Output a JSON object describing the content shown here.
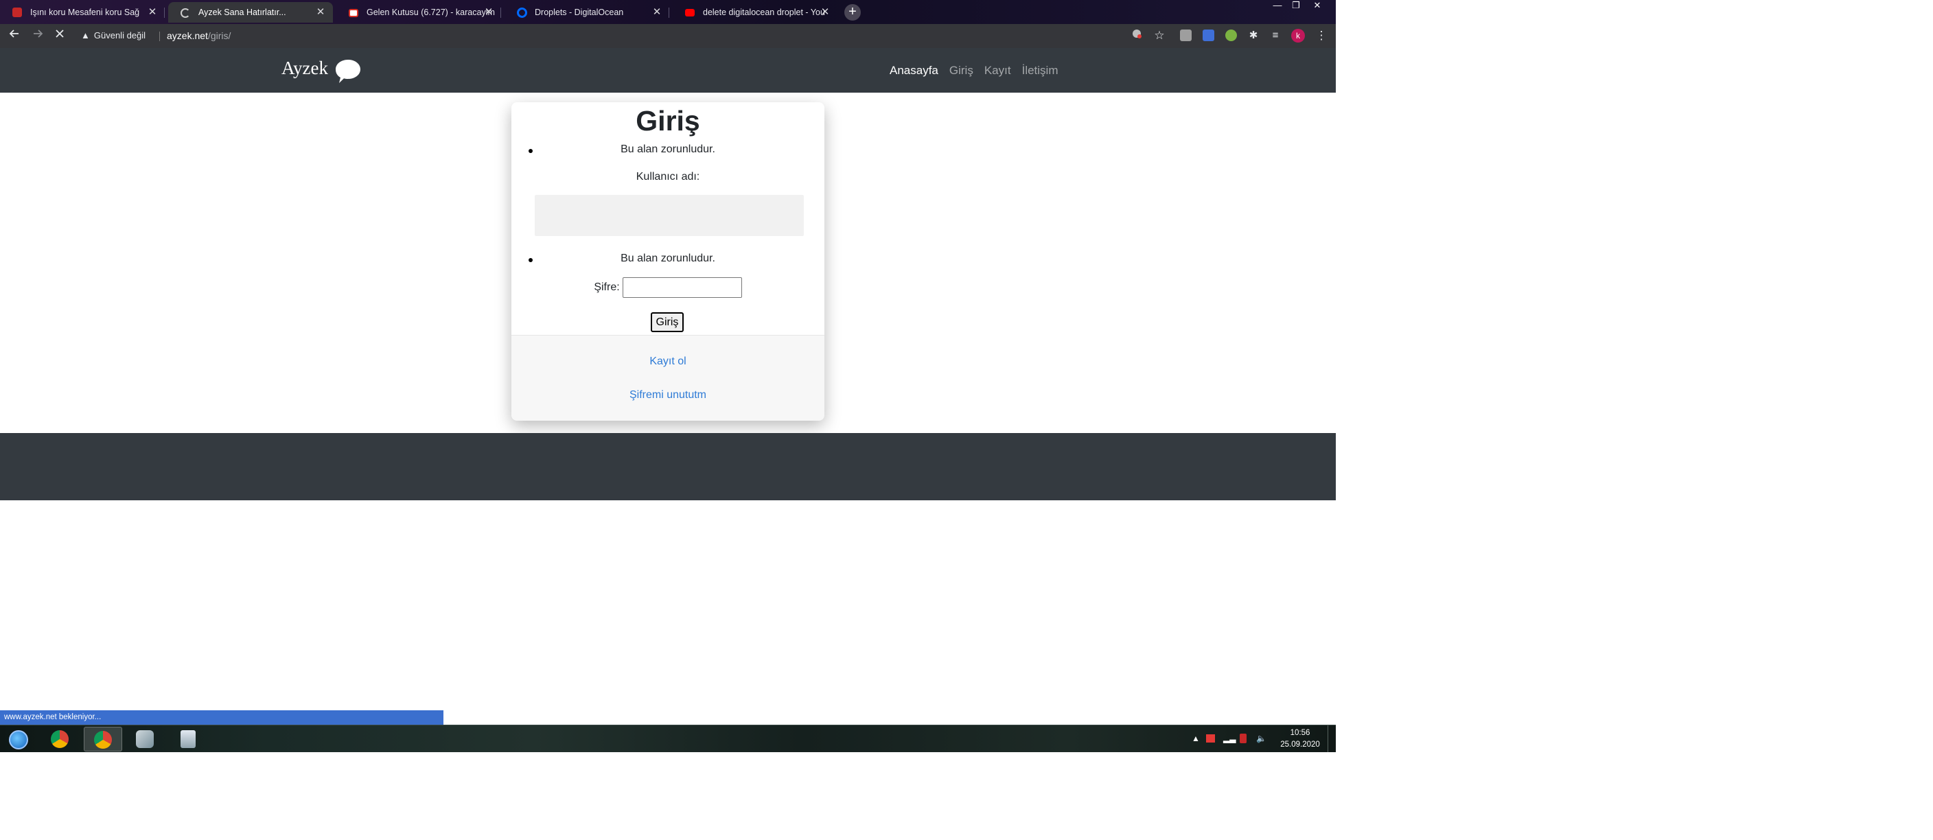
{
  "browser": {
    "tabs": [
      {
        "title": "Işını koru Mesafeni koru Sağ",
        "favicon_color": "#c62828",
        "active": false
      },
      {
        "title": "Ayzek Sana Hatırlatır...",
        "favicon_color": "#cccccc",
        "active": true
      },
      {
        "title": "Gelen Kutusu (6.727) - karacaylm",
        "favicon_color": "#d93025",
        "active": false
      },
      {
        "title": "Droplets - DigitalOcean",
        "favicon_color": "#0069ff",
        "active": false
      },
      {
        "title": "delete digitalocean droplet - You",
        "favicon_color": "#ff0000",
        "active": false
      }
    ],
    "new_tab_symbol": "+",
    "window_controls": {
      "minimize": "—",
      "restore": "❐",
      "close": "✕"
    },
    "toolbar": {
      "back_icon": "arrow-left-icon",
      "forward_icon": "arrow-right-icon",
      "stop_icon": "close-icon",
      "security_warning": "Güvenli değil",
      "url_host": "ayzek.net",
      "url_path": "/giris/",
      "profile_initial": "k"
    }
  },
  "site": {
    "brand": "Ayzek",
    "nav": [
      {
        "label": "Anasayfa",
        "active": true
      },
      {
        "label": "Giriş",
        "active": false
      },
      {
        "label": "Kayıt",
        "active": false
      },
      {
        "label": "İletişim",
        "active": false
      }
    ],
    "login": {
      "title": "Giriş",
      "username_error": "Bu alan zorunludur.",
      "username_label": "Kullanıcı adı:",
      "username_value": "",
      "password_error": "Bu alan zorunludur.",
      "password_label": "Şifre:",
      "password_value": "",
      "submit_label": "Giriş",
      "register_link": "Kayıt ol",
      "forgot_link": "Şifremi unututm"
    }
  },
  "status_bar": "www.ayzek.net bekleniyor...",
  "taskbar": {
    "time": "10:56",
    "date": "25.09.2020"
  }
}
